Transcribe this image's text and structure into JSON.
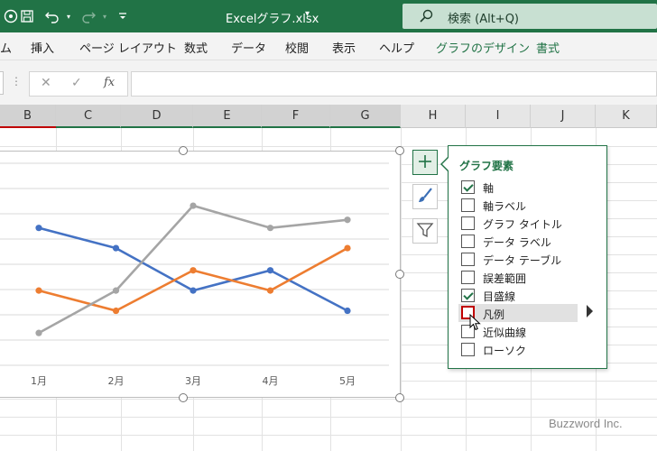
{
  "titlebar": {
    "filename": "Excelグラフ.xlsx",
    "search_text": "検索 (Alt+Q)"
  },
  "menu": {
    "items": [
      "ム",
      "挿入",
      "ページ レイアウト",
      "数式",
      "データ",
      "校閲",
      "表示",
      "ヘルプ",
      "グラフのデザイン",
      "書式"
    ]
  },
  "formula": {
    "cancel": "✕",
    "enter": "✓",
    "fx": "fx"
  },
  "columns": [
    "B",
    "C",
    "D",
    "E",
    "F",
    "G",
    "H",
    "I",
    "J",
    "K"
  ],
  "chart_data": {
    "type": "line",
    "categories": [
      "1月",
      "2月",
      "3月",
      "4月",
      "5月"
    ],
    "series": [
      {
        "color": "#4472c4",
        "values": [
          68,
          58,
          37,
          47,
          27
        ]
      },
      {
        "color": "#ed7d31",
        "values": [
          37,
          27,
          47,
          37,
          58
        ]
      },
      {
        "color": "#a5a5a5",
        "values": [
          16,
          37,
          79,
          68,
          72
        ]
      }
    ],
    "ylim": [
      0,
      100
    ],
    "grid": true,
    "legend": "none"
  },
  "flyout": {
    "title": "グラフ要素",
    "items": [
      {
        "label": "軸",
        "checked": true
      },
      {
        "label": "軸ラベル",
        "checked": false
      },
      {
        "label": "グラフ タイトル",
        "checked": false
      },
      {
        "label": "データ ラベル",
        "checked": false
      },
      {
        "label": "データ テーブル",
        "checked": false
      },
      {
        "label": "誤差範囲",
        "checked": false
      },
      {
        "label": "目盛線",
        "checked": true
      },
      {
        "label": "凡例",
        "checked": false
      },
      {
        "label": "近似曲線",
        "checked": false
      },
      {
        "label": "ローソク",
        "checked": false
      }
    ]
  },
  "watermark": "Buzzword Inc."
}
